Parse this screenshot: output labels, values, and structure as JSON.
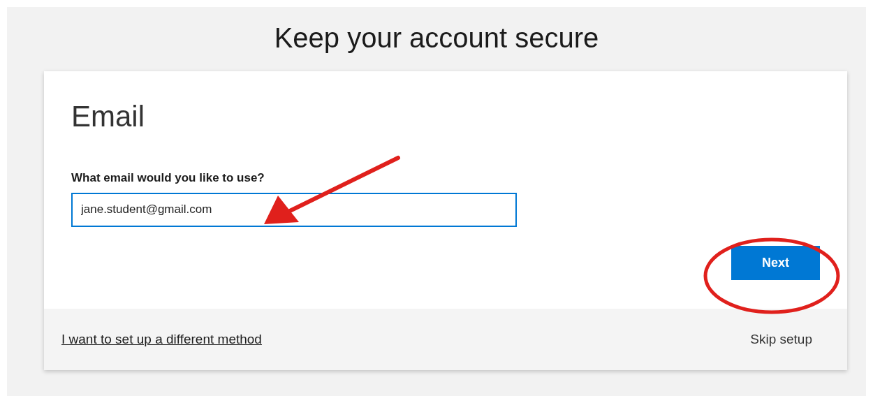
{
  "page_title": "Keep your account secure",
  "card": {
    "heading": "Email",
    "field": {
      "label": "What email would you like to use?",
      "value": "jane.student@gmail.com",
      "focused": true
    },
    "next_button": "Next",
    "footer": {
      "method_link": "I want to set up a different method",
      "skip": "Skip setup"
    }
  }
}
